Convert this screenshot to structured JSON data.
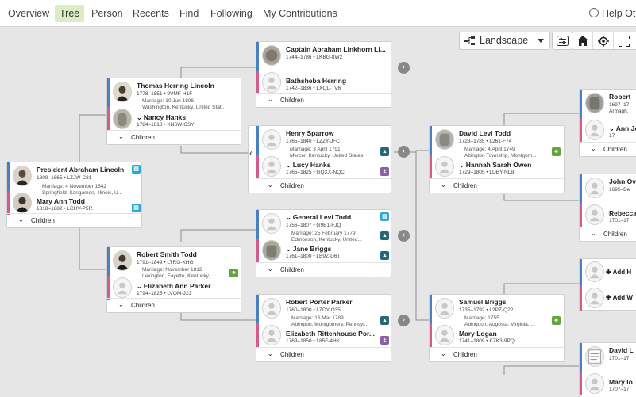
{
  "nav": {
    "tabs": [
      "Overview",
      "Tree",
      "Person",
      "Recents",
      "Find",
      "Following",
      "My Contributions"
    ],
    "active": "Tree",
    "help": "Help Ot"
  },
  "toolbar": {
    "view_select": "Landscape"
  },
  "children_label": "Children",
  "people": {
    "abraham": {
      "name": "President Abraham Lincoln",
      "vitals": "1809–1865 • LZJW-C31",
      "marriage": [
        "Marriage: 4 November 1842",
        "Springfield, Sangamon, Illinois, U..."
      ]
    },
    "mary": {
      "name": "Mary Ann Todd",
      "vitals": "1818–1882 • LCHV-P5R"
    },
    "thomas": {
      "name": "Thomas Herring Lincoln",
      "vitals": "1778–1851 • 9VMF-H1F",
      "marriage": [
        "Marriage: 10 Jun 1806",
        "Washington, Kentucky, United Stat..."
      ]
    },
    "nancy": {
      "name": "Nancy Hanks",
      "vitals": "1784–1818 • KN6W-CSY"
    },
    "robert_smith": {
      "name": "Robert Smith Todd",
      "vitals": "1791–1849 • LTRG-XHG",
      "marriage": [
        "Marriage: November 1812",
        "Lexington, Fayette, Kentucky,..."
      ]
    },
    "elizabeth_ann": {
      "name": "Elizabeth Ann Parker",
      "vitals": "1794–1825 • LVQM-J2J"
    },
    "captain": {
      "name": "Captain Abraham Linkhorn Li...",
      "vitals": "1744–1786 • LKBG-8W2"
    },
    "bathsheba": {
      "name": "Bathsheba Herring",
      "vitals": "1742–1836 • LXQL-TV6"
    },
    "henry": {
      "name": "Henry Sparrow",
      "vitals": "1765–1840 • LZZY-JFC",
      "marriage": [
        "Marriage: 3 April 1791",
        "Mercer, Kentucky, United States"
      ]
    },
    "lucy": {
      "name": "Lucy Hanks",
      "vitals": "1765–1825 • GQXX-NQC"
    },
    "levi": {
      "name": "General Levi Todd",
      "vitals": "1756–1807 • G9B1-FJQ",
      "marriage": [
        "Marriage: 25 February 1779",
        "Edmonson, Kentucky, United..."
      ]
    },
    "jane": {
      "name": "Jane Briggs",
      "vitals": "1761–1800 • LB9Z-D6T"
    },
    "robert_porter": {
      "name": "Robert Porter Parker",
      "vitals": "1760–1800 • LZDY-Q35",
      "marriage": [
        "Marriage: 16 Mar 1789",
        "Abington, Montgomery, Pennsyl..."
      ]
    },
    "elizabeth_ritt": {
      "name": "Elizabeth Rittenhouse Por...",
      "vitals": "1769–1850 • L85F-4HK"
    },
    "david_levi": {
      "name": "David Levi Todd",
      "vitals": "1723–1785 • L261-F74",
      "marriage": [
        "Marriage: 4 April 1749",
        "Abington Township, Montgom..."
      ]
    },
    "hannah": {
      "name": "Hannah Sarah Owen",
      "vitals": "1729–1805 • LDBY-NLB"
    },
    "samuel": {
      "name": "Samuel Briggs",
      "vitals": "1735–1792 • L2PZ-Q22",
      "marriage": [
        "Marriage: 1755",
        "Abingdon, Augusta, Virginia, ..."
      ]
    },
    "mary_logan": {
      "name": "Mary Logan",
      "vitals": "1741–1809 • KZK3-9PQ"
    },
    "robert_far": {
      "name": "Robert",
      "vitals": "1697–17",
      "place": "Armagh,"
    },
    "ann_far": {
      "name": "Ann Jea",
      "vitals": "17"
    },
    "john_far": {
      "name": "John Ov",
      "vitals": "1695–De"
    },
    "rebecca_far": {
      "name": "Rebecca",
      "vitals": "1701–17"
    },
    "david_far": {
      "name": "David L",
      "vitals": "1701–17"
    },
    "mary_far": {
      "name": "Mary lo",
      "vitals": "1707–17"
    }
  },
  "add_labels": [
    "Add H",
    "Add W"
  ]
}
